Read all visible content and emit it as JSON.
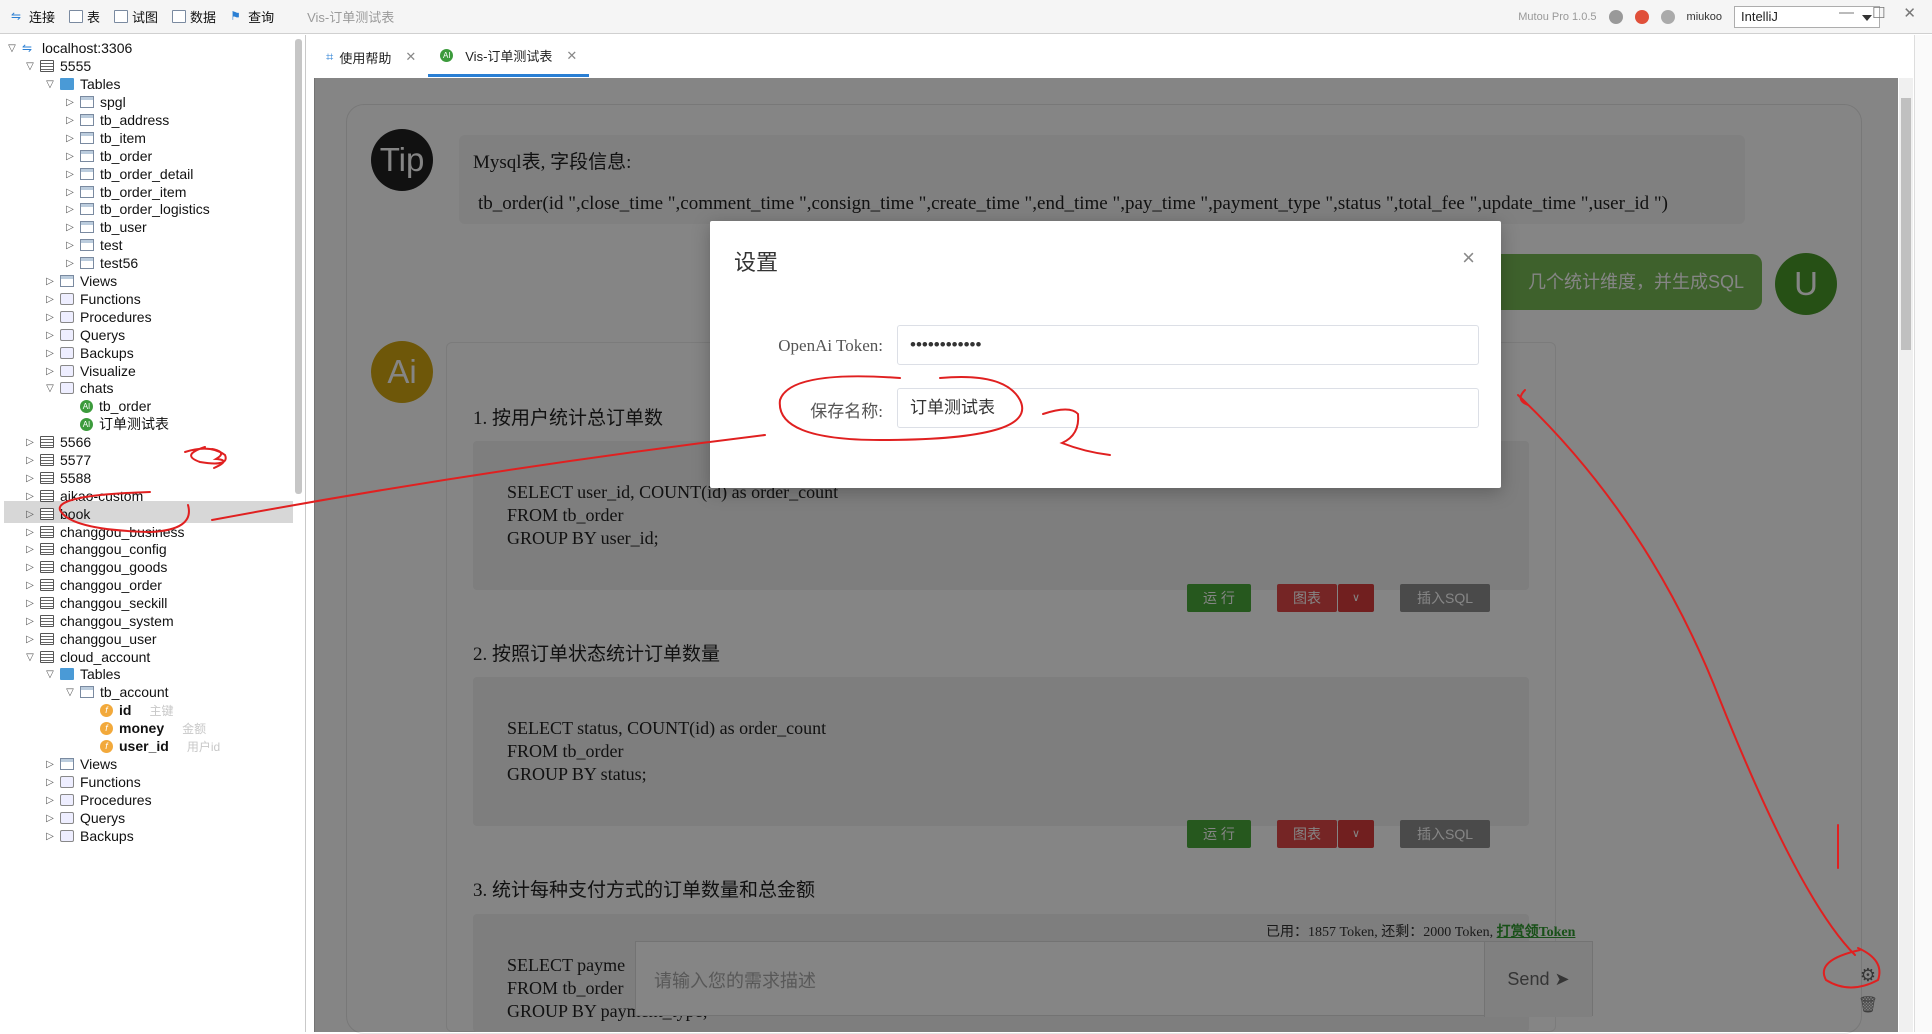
{
  "toolbar": {
    "items": [
      "连接",
      "表",
      "试图",
      "数据",
      "查询"
    ],
    "window_title": "Vis-订单测试表",
    "version": "Mutou Pro 1.0.5",
    "user": "miukoo",
    "theme": "IntelliJ"
  },
  "tree": {
    "connection": "localhost:3306",
    "db1": "5555",
    "tables_label": "Tables",
    "tables": [
      "spgl",
      "tb_address",
      "tb_item",
      "tb_order",
      "tb_order_detail",
      "tb_order_item",
      "tb_order_logistics",
      "tb_user",
      "test",
      "test56"
    ],
    "groups1": [
      "Views",
      "Functions",
      "Procedures",
      "Querys",
      "Backups",
      "Visualize",
      "chats"
    ],
    "chats": [
      "tb_order",
      "订单测试表"
    ],
    "dbs": [
      "5566",
      "5577",
      "5588",
      "aikao-custom",
      "book",
      "changgou_business",
      "changgou_config",
      "changgou_goods",
      "changgou_order",
      "changgou_seckill",
      "changgou_system",
      "changgou_user",
      "cloud_account"
    ],
    "cloud_tables_label": "Tables",
    "cloud_table": "tb_account",
    "fields": [
      {
        "name": "id",
        "comment": "主键"
      },
      {
        "name": "money",
        "comment": "金额"
      },
      {
        "name": "user_id",
        "comment": "用户id"
      }
    ],
    "groups2": [
      "Views",
      "Functions",
      "Procedures",
      "Querys",
      "Backups"
    ]
  },
  "tabs": [
    {
      "label": "使用帮助"
    },
    {
      "label": "Vis-订单测试表"
    }
  ],
  "chat": {
    "tip_avatar": "Tip",
    "tip_line1": "Mysql表, 字段信息:",
    "tip_line2": "tb_order(id \",close_time \",comment_time \",consign_time \",create_time \",end_time \",pay_time \",payment_type \",status \",total_fee \",update_time \",user_id \")",
    "user_avatar": "U",
    "user_message": "几个统计维度，并生成SQL",
    "ai_avatar": "Ai",
    "sections": [
      {
        "title": "1. 按用户统计总订单数",
        "code": "SELECT user_id, COUNT(id) as order_count\nFROM tb_order\nGROUP BY user_id;"
      },
      {
        "title": "2. 按照订单状态统计订单数量",
        "code": "SELECT status, COUNT(id) as order_count\nFROM tb_order\nGROUP BY status;"
      },
      {
        "title": "3. 统计每种支付方式的订单数量和总金额",
        "code": "SELECT payme\nFROM tb_order\nGROUP BY payment_type;"
      }
    ],
    "btn_run": "运 行",
    "btn_chart": "图表",
    "btn_chart_dd": "∨",
    "btn_insert": "插入SQL",
    "token_info": "已用：1857 Token, 还剩：2000 Token,",
    "token_link": "打赏领Token",
    "input_placeholder": "请输入您的需求描述",
    "send_label": "Send"
  },
  "modal": {
    "title": "设置",
    "close": "×",
    "token_label": "OpenAi Token:",
    "token_value": "••••••••••••",
    "name_label": "保存名称:",
    "name_value": "订单测试表"
  }
}
